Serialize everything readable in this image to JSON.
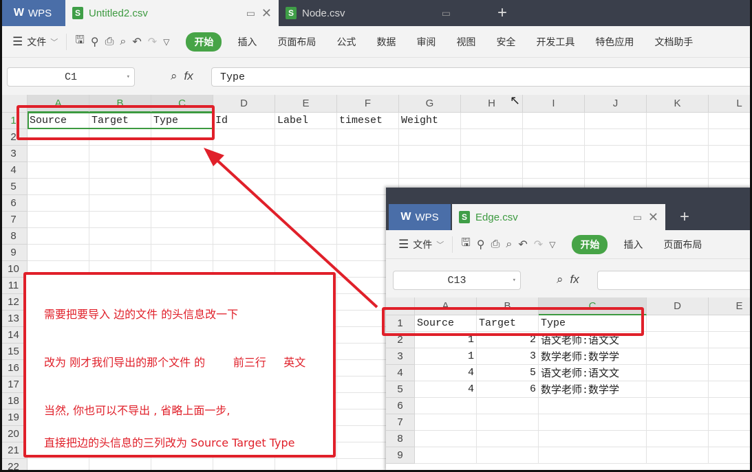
{
  "main": {
    "app_tab": "WPS",
    "tabs": [
      {
        "label": "Untitled2.csv",
        "active": true
      },
      {
        "label": "Node.csv",
        "active": false
      }
    ],
    "menu_label": "文件",
    "ribbon_tabs": [
      "开始",
      "插入",
      "页面布局",
      "公式",
      "数据",
      "审阅",
      "视图",
      "安全",
      "开发工具",
      "特色应用",
      "文档助手"
    ],
    "active_ribbon_tab": "开始",
    "namebox": "C1",
    "formula": "Type",
    "columns": [
      "A",
      "B",
      "C",
      "D",
      "E",
      "F",
      "G",
      "H",
      "I",
      "J",
      "K",
      "L"
    ],
    "rows": [
      "1",
      "2",
      "3",
      "4",
      "5",
      "6",
      "7",
      "8",
      "9",
      "10",
      "11",
      "12",
      "13",
      "14",
      "15",
      "16",
      "17",
      "18",
      "19",
      "20",
      "21",
      "22"
    ],
    "header_cells": [
      "Source",
      "Target",
      "Type",
      "Id",
      "Label",
      "timeset",
      "Weight"
    ]
  },
  "edge": {
    "app_tab": "WPS",
    "tab_label": "Edge.csv",
    "menu_label": "文件",
    "ribbon_tabs": [
      "开始",
      "插入",
      "页面布局"
    ],
    "namebox": "C13",
    "formula": "",
    "columns": [
      "A",
      "B",
      "C",
      "D",
      "E"
    ],
    "rows": [
      "1",
      "2",
      "3",
      "4",
      "5",
      "6",
      "7",
      "8",
      "9"
    ],
    "table": [
      [
        "Source",
        "Target",
        "Type"
      ],
      [
        "1",
        "2",
        "语文老师:语文文"
      ],
      [
        "1",
        "3",
        "数学老师:数学学"
      ],
      [
        "4",
        "5",
        "语文老师:语文文"
      ],
      [
        "4",
        "6",
        "数学老师:数学学"
      ]
    ]
  },
  "annotation": {
    "lines": [
      "需要把要导入 边的文件 的头信息改一下",
      "改为 刚才我们导出的那个文件 的        前三行     英文",
      "当然, 你也可以不导出 , 省略上面一步,",
      "直接把边的头信息的三列改为 Source Target Type"
    ],
    "color": "#e0202a"
  },
  "colors": {
    "accent_green": "#47a447",
    "wps_blue": "#4a6ea8",
    "tabbar_dark": "#3a3f4b"
  }
}
